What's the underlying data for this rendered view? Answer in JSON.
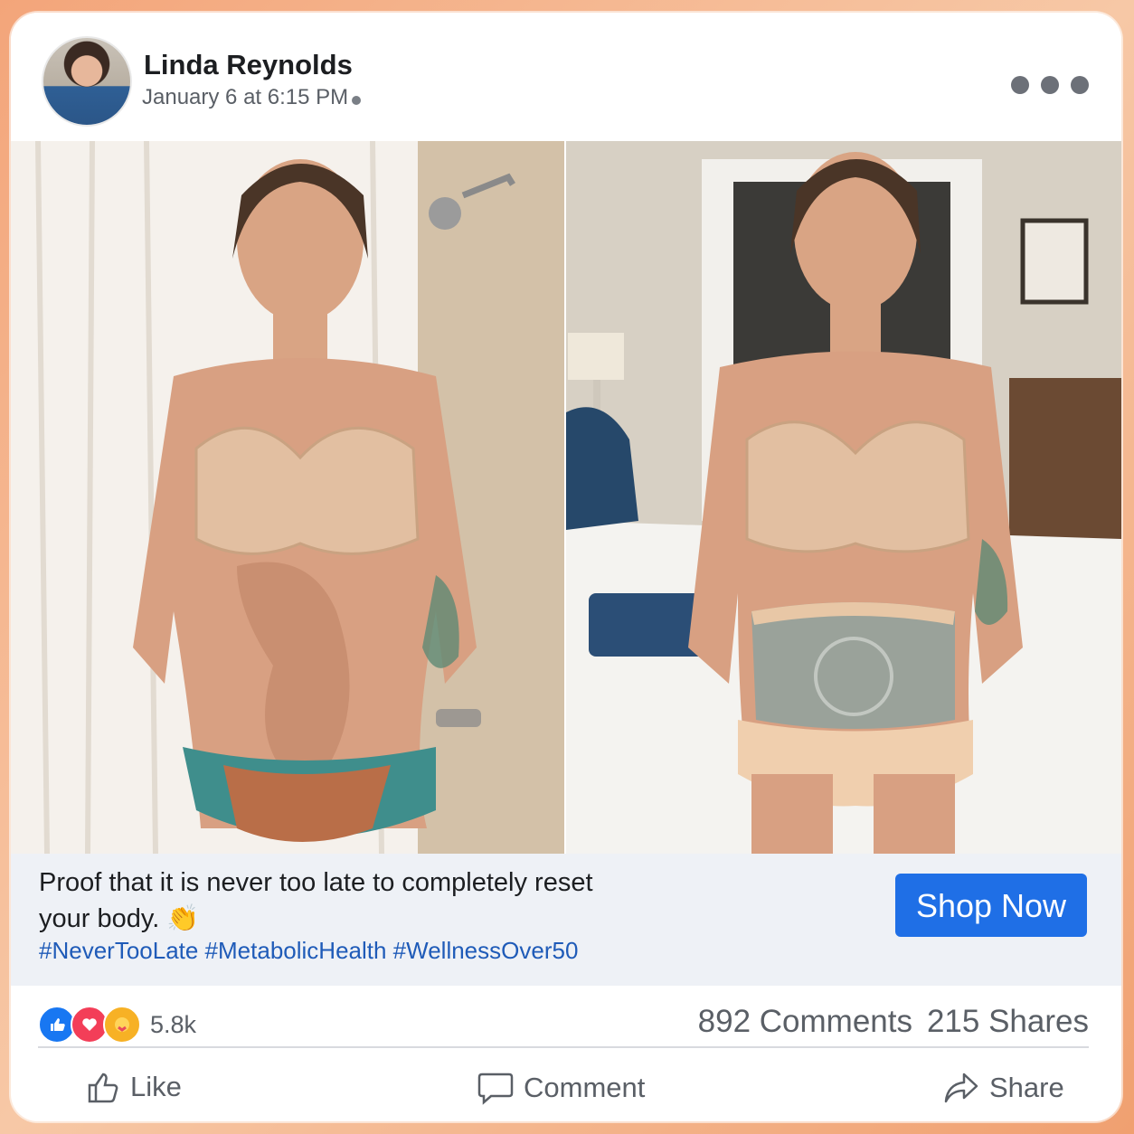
{
  "post": {
    "author": "Linda Reynolds",
    "timestamp": "January 6 at 6:15 PM",
    "caption": "Proof that it is never too late to completely reset your body. 👏",
    "hashtags": "#NeverTooLate #MetabolicHealth #WellnessOver50",
    "cta_label": "Shop Now"
  },
  "engagement": {
    "reaction_count": "5.8k",
    "comments": "892 Comments",
    "shares": "215 Shares"
  },
  "actions": {
    "like": "Like",
    "comment": "Comment",
    "share": "Share"
  },
  "icons": [
    "avatar",
    "privacy-globe-icon",
    "more-options-icon",
    "like-reaction-icon",
    "love-reaction-icon",
    "care-reaction-icon",
    "thumbs-up-icon",
    "comment-bubble-icon",
    "share-arrow-icon"
  ],
  "colors": {
    "link": "#1f5bb8",
    "button": "#1f6fe6",
    "like": "#1877f2",
    "love": "#f33e58",
    "care": "#f7b125"
  },
  "images": [
    "before-photo",
    "after-photo"
  ]
}
